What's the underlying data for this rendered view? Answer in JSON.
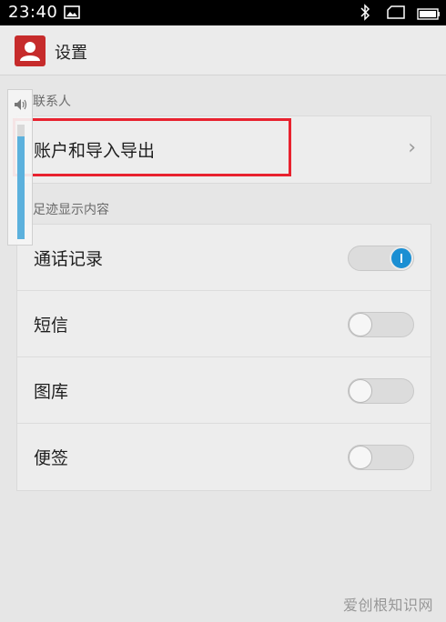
{
  "status_bar": {
    "time": "23:40",
    "icons": [
      "picture-icon",
      "bluetooth-icon",
      "screen-icon",
      "battery-icon"
    ]
  },
  "header": {
    "title": "设置",
    "app_icon": "contact-icon",
    "app_icon_color": "#c62b2b"
  },
  "contacts_section": {
    "heading": "联系人",
    "rows": [
      {
        "label": "账户和导入导出",
        "chevron": "›"
      }
    ]
  },
  "footprint_section": {
    "heading": "足迹显示内容",
    "rows": [
      {
        "label": "通话记录",
        "toggle_on": true
      },
      {
        "label": "短信",
        "toggle_on": false
      },
      {
        "label": "图库",
        "toggle_on": false
      },
      {
        "label": "便签",
        "toggle_on": false
      }
    ]
  },
  "volume": {
    "level": 0.9
  },
  "watermark": "爱创根知识网",
  "colors": {
    "accent": "#1b8fd3",
    "highlight": "#e8222f",
    "volume_fill": "#5cb1dd"
  }
}
